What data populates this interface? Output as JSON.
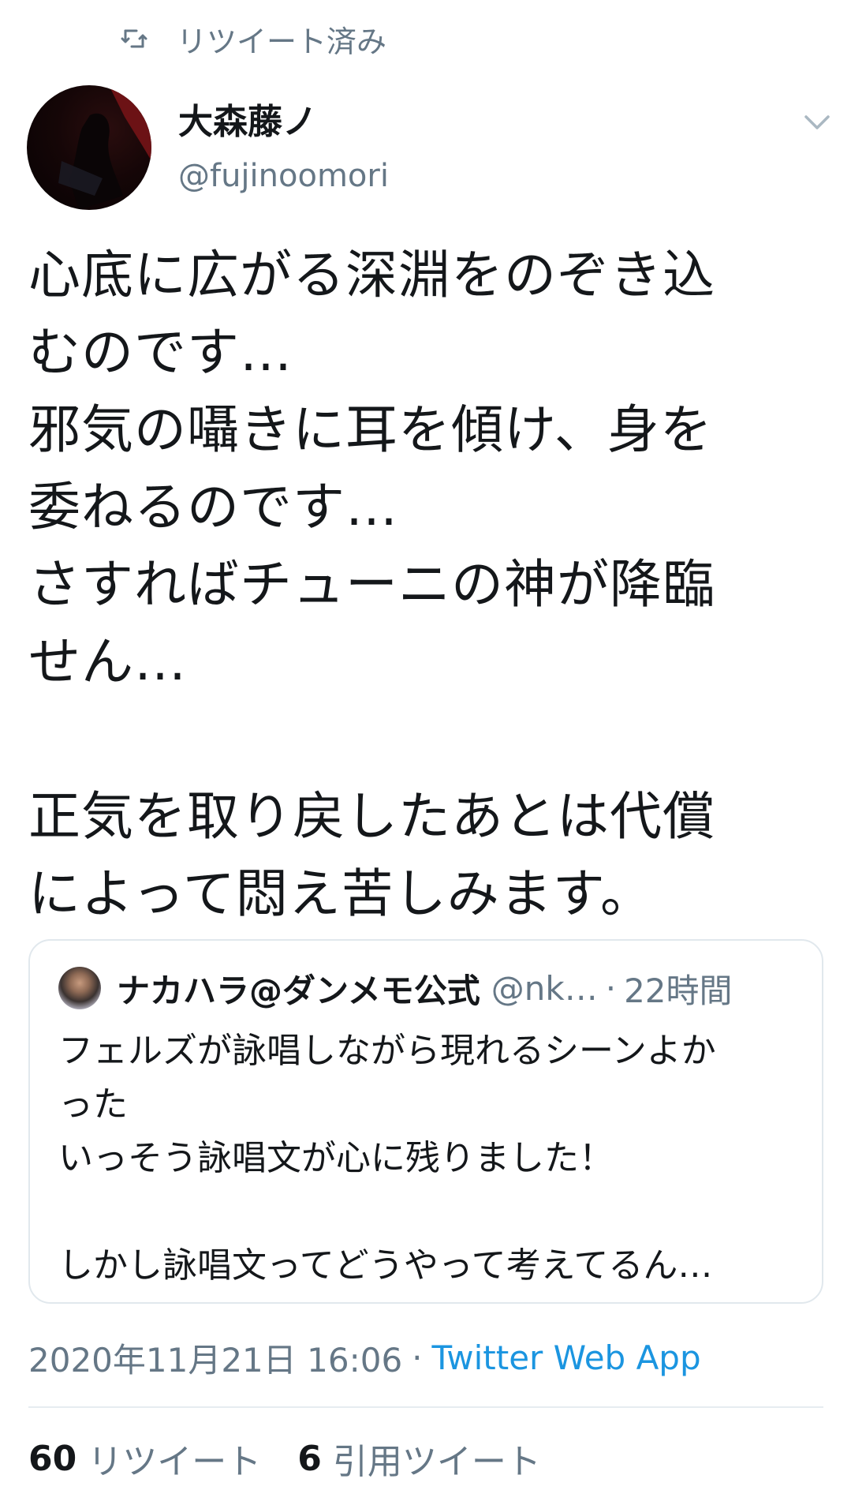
{
  "retweet_banner": {
    "icon": "retweet-icon",
    "label": "リツイート済み"
  },
  "author": {
    "name": "大森藤ノ",
    "handle": "@fujinoomori",
    "avatar": "avatar"
  },
  "menu": {
    "icon": "chevron-down-icon"
  },
  "tweet": {
    "lines": [
      "心底に広がる深淵をのぞき込",
      "むのです…",
      "邪気の囁きに耳を傾け、身を",
      "委ねるのです…",
      "さすればチューニの神が降臨",
      "せん…",
      "",
      "正気を取り戻したあとは代償",
      "によって悶え苦しみます。"
    ]
  },
  "quoted": {
    "name": "ナカハラ@ダンメモ公式",
    "handle": "@nk…",
    "separator": "·",
    "time": "22時間",
    "lines": [
      "フェルズが詠唱しながら現れるシーンよか",
      "った",
      "いっそう詠唱文が心に残りました！",
      "",
      "しかし詠唱文ってどうやって考えてるん…"
    ]
  },
  "meta": {
    "timestamp": "2020年11月21日 16:06",
    "separator": "·",
    "source": "Twitter Web App"
  },
  "stats": {
    "retweets_count": "60",
    "retweets_label": "リツイート",
    "quotes_count": "6",
    "quotes_label": "引用ツイート"
  },
  "colors": {
    "text": "#14171a",
    "secondary": "#657786",
    "link": "#1b95e0",
    "border": "#e1e8ed"
  }
}
